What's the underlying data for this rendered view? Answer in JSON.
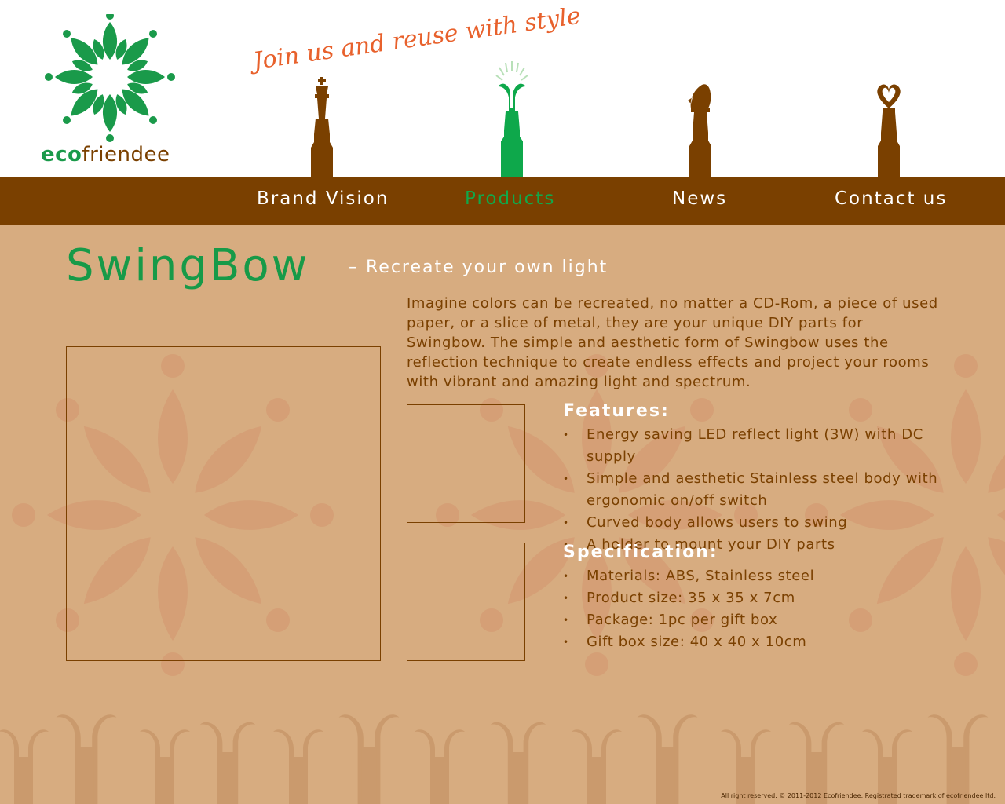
{
  "brand": {
    "logo_prefix": "eco",
    "logo_suffix": "friendee",
    "tagline": "Join us and reuse with style!"
  },
  "nav": {
    "items": [
      {
        "label": "Brand Vision",
        "active": false
      },
      {
        "label": "Products",
        "active": true
      },
      {
        "label": "News",
        "active": false
      },
      {
        "label": "Contact us",
        "active": false
      }
    ]
  },
  "product": {
    "title": "SwingBow",
    "subtitle": "– Recreate your own light",
    "intro": "Imagine colors can be recreated, no matter a CD-Rom, a piece of used paper, or a slice of metal, they are your unique DIY parts for Swingbow. The simple and aesthetic form of Swingbow uses the reflection technique to create endless effects and project your rooms with vibrant and amazing light and spectrum."
  },
  "features": {
    "heading": "Features:",
    "items": [
      "Energy saving LED reflect light (3W) with DC supply",
      "Simple and aesthetic Stainless steel body with ergonomic on/off switch",
      "Curved body allows users to swing",
      "A holder to mount your DIY parts"
    ]
  },
  "specification": {
    "heading": "Specification:",
    "items": [
      "Materials: ABS, Stainless steel",
      "Product size: 35 x 35 x 7cm",
      "Package: 1pc per gift box",
      "Gift box size: 40 x 40 x 10cm"
    ]
  },
  "bullet_glyph": "•",
  "footer": {
    "text": "All right reserved. © 2011-2012 Ecofriendee. Registrated trademark of ecofriendee ltd."
  },
  "colors": {
    "brand_green": "#179a48",
    "brand_brown": "#7a4000",
    "content_bg": "#d7ac80",
    "tagline_orange": "#e8612c"
  }
}
